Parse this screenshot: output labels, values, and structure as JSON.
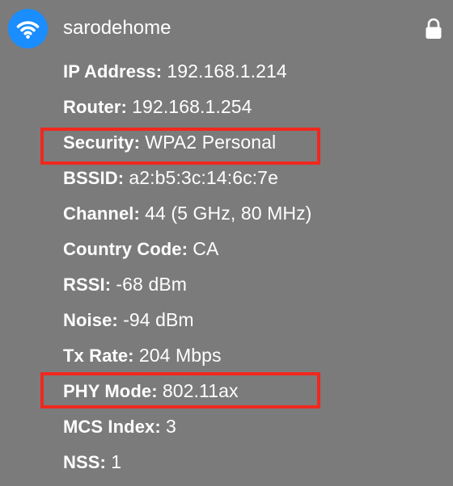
{
  "network": {
    "name": "sarodehome",
    "icon": "wifi-icon",
    "lock_icon": "lock-icon",
    "accent_color": "#1a8dff"
  },
  "details": [
    {
      "label": "IP Address:",
      "value": "192.168.1.214"
    },
    {
      "label": "Router:",
      "value": "192.168.1.254"
    },
    {
      "label": "Security:",
      "value": "WPA2 Personal"
    },
    {
      "label": "BSSID:",
      "value": "a2:b5:3c:14:6c:7e"
    },
    {
      "label": "Channel:",
      "value": "44 (5 GHz, 80 MHz)"
    },
    {
      "label": "Country Code:",
      "value": "CA"
    },
    {
      "label": "RSSI:",
      "value": "-68 dBm"
    },
    {
      "label": "Noise:",
      "value": "-94 dBm"
    },
    {
      "label": "Tx Rate:",
      "value": "204 Mbps"
    },
    {
      "label": "PHY Mode:",
      "value": "802.11ax"
    },
    {
      "label": "MCS Index:",
      "value": "3"
    },
    {
      "label": "NSS:",
      "value": "1"
    }
  ],
  "highlight_color": "#f0281e"
}
